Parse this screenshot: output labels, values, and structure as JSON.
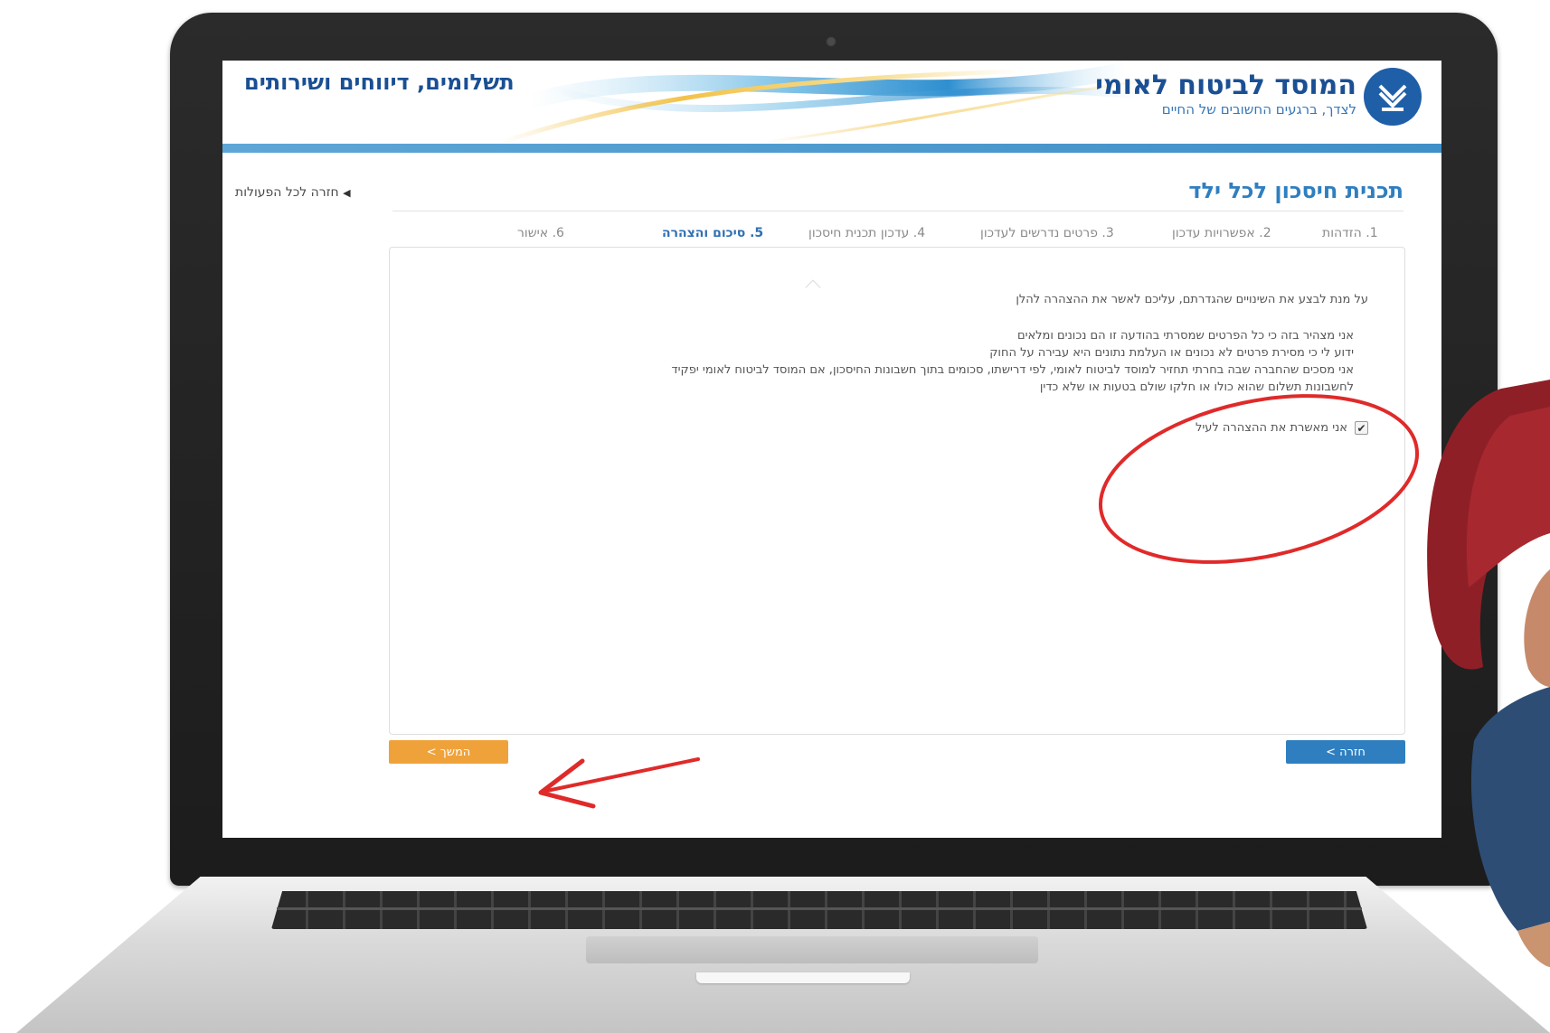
{
  "header": {
    "org_name": "המוסד לביטוח לאומי",
    "org_tagline": "לצדך, ברגעים החשובים של החיים",
    "section_title": "תשלומים, דיווחים ושירותים"
  },
  "nav": {
    "back_all_label": "חזרה לכל הפעולות"
  },
  "page": {
    "title": "תכנית חיסכון לכל ילד"
  },
  "steps": [
    {
      "label": "1. הזדהות",
      "active": false
    },
    {
      "label": "2. אפשרויות עדכון",
      "active": false
    },
    {
      "label": "3. פרטים נדרשים לעדכון",
      "active": false
    },
    {
      "label": "4. עדכון תכנית חיסכון",
      "active": false
    },
    {
      "label": "5. סיכום והצהרה",
      "active": true
    },
    {
      "label": "6. אישור",
      "active": false
    }
  ],
  "content": {
    "intro": "על מנת לבצע את השינויים שהגדרתם, עליכם לאשר את ההצהרה להלן",
    "declaration_lines": [
      "אני מצהיר בזה כי כל הפרטים שמסרתי בהודעה זו הם נכונים ומלאים",
      "ידוע לי כי מסירת פרטים לא נכונים או העלמת נתונים היא עבירה על החוק",
      "אני מסכים שהחברה שבה בחרתי תחזיר למוסד לביטוח לאומי, לפי דרישתו, סכומים בתוך חשבונות החיסכון, אם המוסד לביטוח לאומי יפקיד",
      "לחשבונות תשלום שהוא כולו או חלקו שולם בטעות או שלא כדין"
    ],
    "confirm_label": "אני מאשרת את ההצהרה לעיל",
    "confirm_checked": true
  },
  "buttons": {
    "continue_label": "המשך >",
    "back_label": "חזרה >"
  },
  "colors": {
    "brand_blue": "#1a4f93",
    "accent_blue": "#2f7fc0",
    "continue_orange": "#f0a23a",
    "annotation_red": "#e02a2a"
  },
  "icons": {
    "logo": "nii-menorah-emblem-icon",
    "back": "triangle-left-icon",
    "check": "checkmark-icon"
  }
}
